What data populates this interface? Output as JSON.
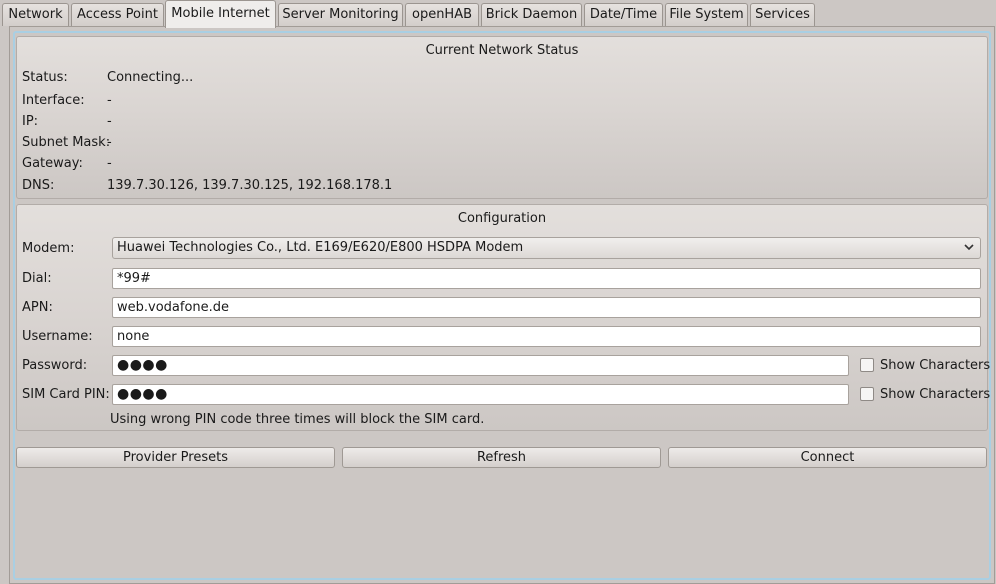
{
  "tabs": [
    {
      "label": "Network"
    },
    {
      "label": "Access Point"
    },
    {
      "label": "Mobile Internet"
    },
    {
      "label": "Server Monitoring"
    },
    {
      "label": "openHAB"
    },
    {
      "label": "Brick Daemon"
    },
    {
      "label": "Date/Time"
    },
    {
      "label": "File System"
    },
    {
      "label": "Services"
    }
  ],
  "status": {
    "title": "Current Network Status",
    "rows": [
      {
        "label": "Status:",
        "value": "Connecting..."
      },
      {
        "label": "Interface:",
        "value": "-"
      },
      {
        "label": "IP:",
        "value": "-"
      },
      {
        "label": "Subnet Mask:",
        "value": "-"
      },
      {
        "label": "Gateway:",
        "value": "-"
      },
      {
        "label": "DNS:",
        "value": "139.7.30.126, 139.7.30.125, 192.168.178.1"
      }
    ]
  },
  "config": {
    "title": "Configuration",
    "modem_label": "Modem:",
    "modem_value": "Huawei Technologies Co., Ltd. E169/E620/E800 HSDPA Modem",
    "dial_label": "Dial:",
    "dial_value": "*99#",
    "apn_label": "APN:",
    "apn_value": "web.vodafone.de",
    "username_label": "Username:",
    "username_value": "none",
    "password_label": "Password:",
    "password_value": "●●●●",
    "password_show_label": "Show Characters",
    "pin_label": "SIM Card PIN:",
    "pin_value": "●●●●",
    "pin_show_label": "Show Characters",
    "pin_warning": "Using wrong PIN code three times will block the SIM card."
  },
  "buttons": {
    "presets": "Provider Presets",
    "refresh": "Refresh",
    "connect": "Connect"
  }
}
